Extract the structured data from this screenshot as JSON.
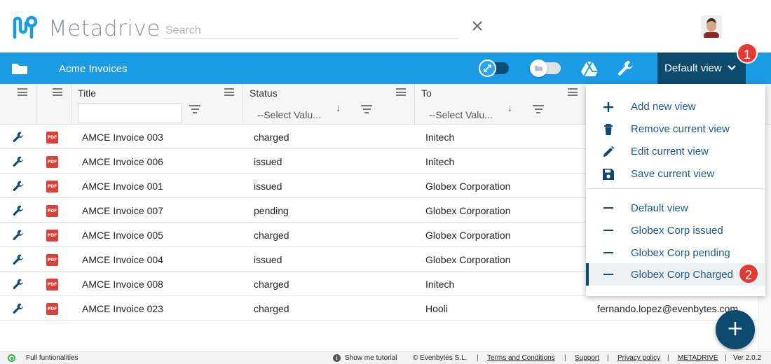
{
  "app": {
    "brand_name": "Metadrive",
    "brand_color": "#1a9be3",
    "dark_accent": "#0c4a6e"
  },
  "search": {
    "placeholder": "Search",
    "value": ""
  },
  "toolbar": {
    "breadcrumb": "Acme Invoices",
    "icons": [
      "folder-icon",
      "collapse-toggle",
      "folder-toggle",
      "google-drive-icon",
      "wrench-icon"
    ],
    "view_button_label": "Default view"
  },
  "badges": {
    "first": "1",
    "second": "2"
  },
  "columns": [
    {
      "label": ""
    },
    {
      "label": ""
    },
    {
      "label": "Title",
      "filter_value": ""
    },
    {
      "label": "Status",
      "select_placeholder": "--Select Valu..."
    },
    {
      "label": "To",
      "select_placeholder": "--Select Valu..."
    }
  ],
  "rows": [
    {
      "title": "AMCE Invoice 003",
      "status": "charged",
      "to": "Initech"
    },
    {
      "title": "AMCE Invoice 006",
      "status": "issued",
      "to": "Initech"
    },
    {
      "title": "AMCE Invoice 001",
      "status": "issued",
      "to": "Globex Corporation"
    },
    {
      "title": "AMCE Invoice 007",
      "status": "pending",
      "to": "Globex Corporation"
    },
    {
      "title": "AMCE Invoice 005",
      "status": "charged",
      "to": "Globex Corporation"
    },
    {
      "title": "AMCE Invoice 004",
      "status": "issued",
      "to": "Globex Corporation"
    },
    {
      "title": "AMCE Invoice 008",
      "status": "charged",
      "to": "Initech"
    },
    {
      "title": "AMCE Invoice 023",
      "status": "charged",
      "to": "Hooli"
    }
  ],
  "row_file_badge": "PDF",
  "partial_email": "fernando.lopez@evenbytes.com",
  "view_menu": {
    "actions": [
      {
        "label": "Add new view",
        "icon": "plus-icon"
      },
      {
        "label": "Remove current view",
        "icon": "trash-icon"
      },
      {
        "label": "Edit current view",
        "icon": "pencil-icon"
      },
      {
        "label": "Save current view",
        "icon": "save-icon"
      }
    ],
    "views": [
      {
        "label": "Default view",
        "active": false
      },
      {
        "label": "Globex Corp issued",
        "active": false
      },
      {
        "label": "Globex Corp pending",
        "active": false
      },
      {
        "label": "Globex Corp Charged",
        "active": true
      }
    ]
  },
  "fab_label": "+",
  "footer": {
    "status_text": "Full funtionalities",
    "info_glyph": "i",
    "tutorial": "Show me tutorial",
    "copyright": "© Evenbytes S.L.",
    "separator": "|",
    "links": [
      "Terms and Conditions",
      "Support",
      "Privacy policy",
      "METADRIVE"
    ],
    "version": "Ver 2.0.2"
  }
}
